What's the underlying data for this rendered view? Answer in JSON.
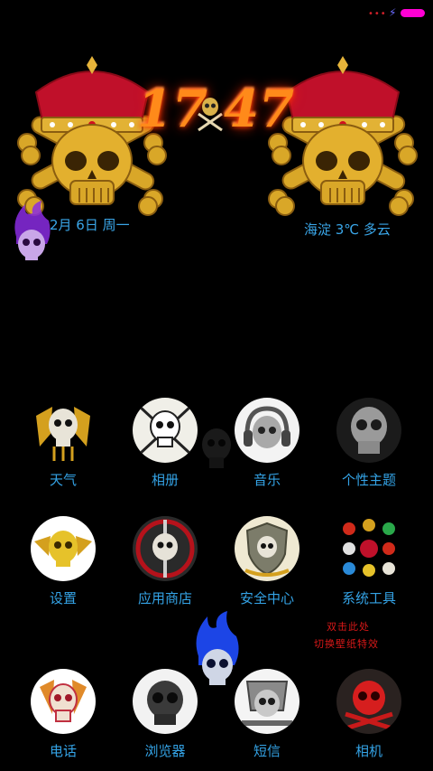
{
  "status_bar": {
    "signal_dots": "•••",
    "charging_icon": "bolt-icon",
    "battery_color": "#ff00d4"
  },
  "clock": {
    "hour": "17",
    "minute": "47",
    "separator_icon": "skull-crossbones-icon"
  },
  "date": {
    "text": "2月 6日 周一"
  },
  "weather": {
    "text": "海淀 3℃ 多云"
  },
  "apps": [
    {
      "label": "天气"
    },
    {
      "label": "相册"
    },
    {
      "label": "音乐"
    },
    {
      "label": "个性主题"
    },
    {
      "label": "设置"
    },
    {
      "label": "应用商店"
    },
    {
      "label": "安全中心"
    },
    {
      "label": "系统工具"
    },
    {
      "label": "电话"
    },
    {
      "label": "浏览器"
    },
    {
      "label": "短信"
    },
    {
      "label": "相机"
    }
  ],
  "wallpaper_hint": {
    "line1": "双击此处",
    "line2": "切换壁纸特效"
  },
  "colors": {
    "label": "#34a3e6",
    "gold": "#d4a01e",
    "crown_red": "#c0102a",
    "hint_red": "#d81818"
  }
}
